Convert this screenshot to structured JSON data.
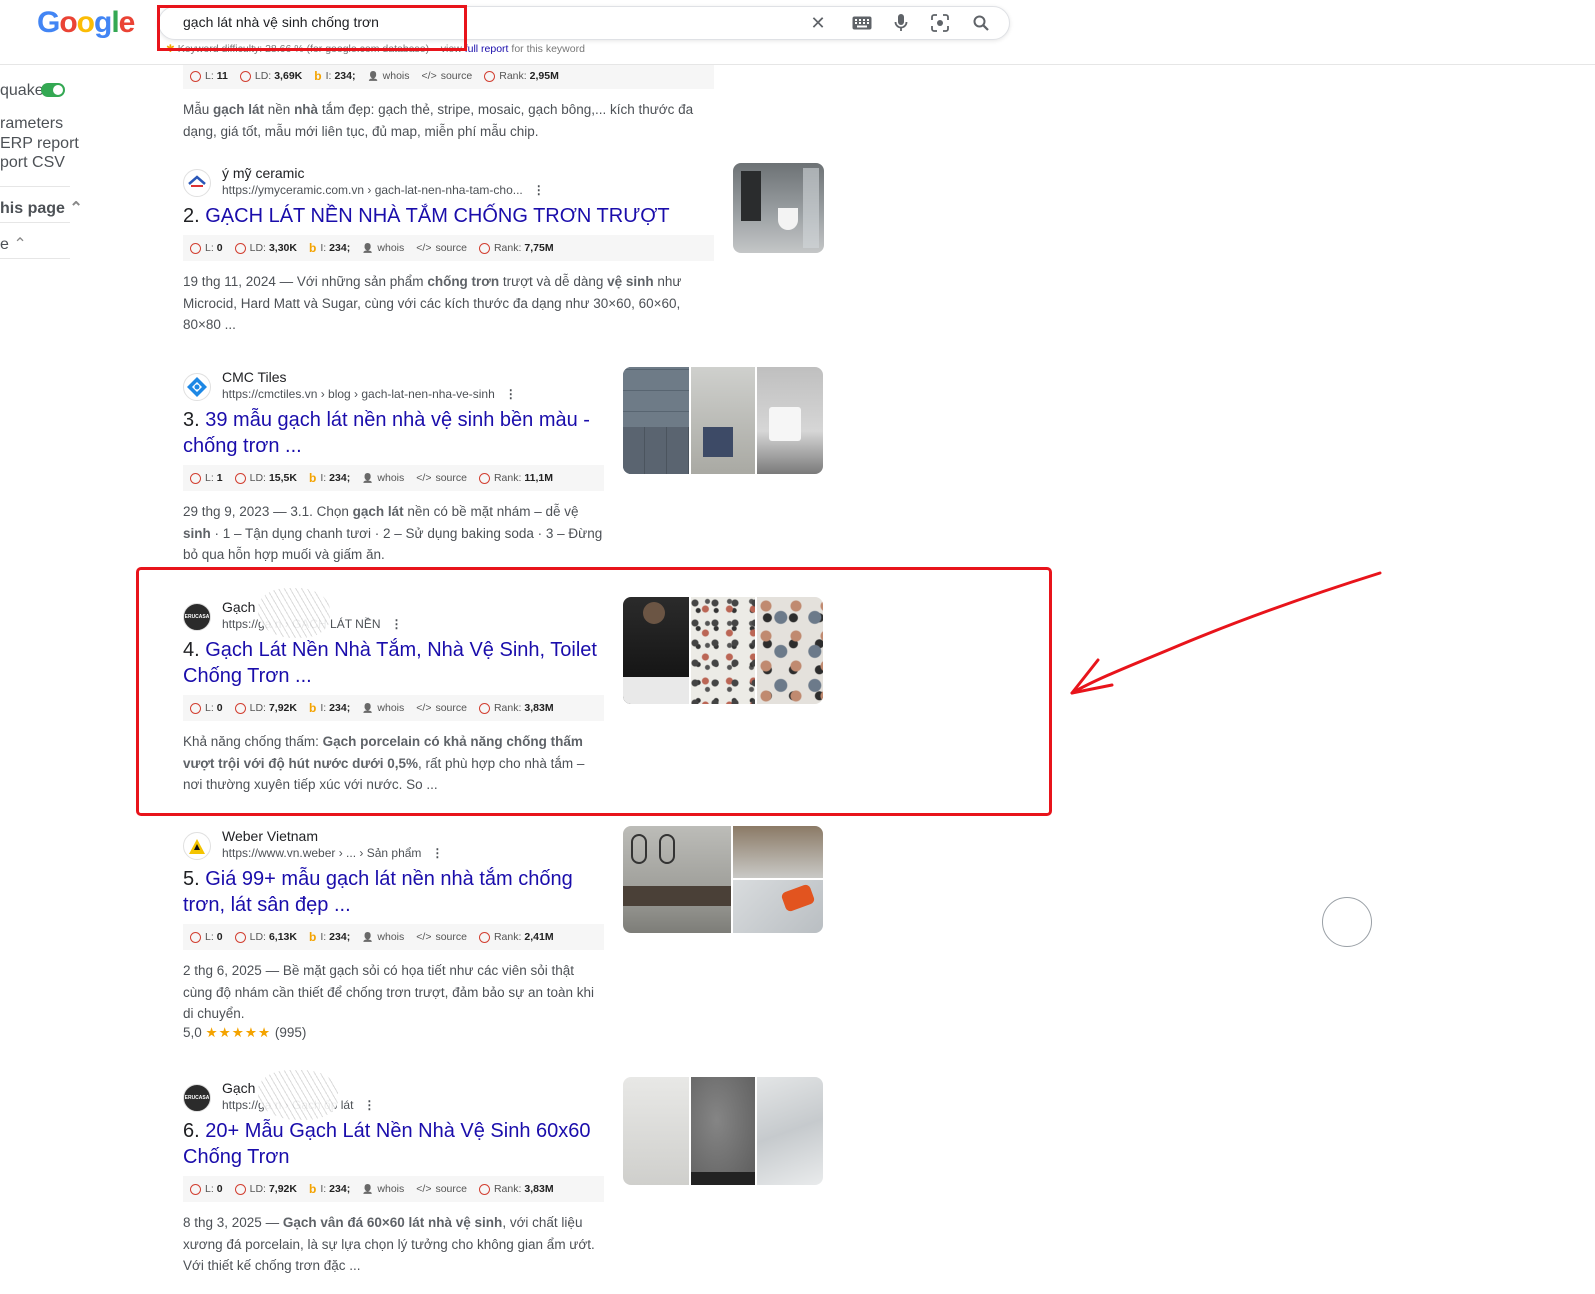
{
  "search": {
    "query": "gạch lát nhà vệ sinh chống trơn",
    "keyword_line_prefix": "Keyword difficulty: 28.66 % (for google.com database) – view",
    "keyword_line_link": "full report",
    "keyword_line_suffix": "for this keyword"
  },
  "logo": [
    "G",
    "o",
    "o",
    "g",
    "l",
    "e"
  ],
  "logo_colors": [
    "#4285f4",
    "#ea4335",
    "#fbbc05",
    "#4285f4",
    "#34a853",
    "#ea4335"
  ],
  "left_panel": {
    "toggle_label": "quake",
    "items": [
      "rameters",
      "ERP report",
      "port CSV"
    ],
    "this_page": "his page",
    "last": "e"
  },
  "metric_labels": {
    "l": "L:",
    "ld": "LD:",
    "i": "I:",
    "whois": "whois",
    "source": "source",
    "rank": "Rank:"
  },
  "result0": {
    "metrics": {
      "l": "11",
      "ld": "3,69K",
      "i": "234;",
      "rank": "2,95M"
    },
    "snippet": "Mẫu <b>gạch lát</b> nền <b>nhà</b> tắm đẹp: gạch thẻ, stripe, mosaic, gạch bông,... kích thước đa dạng, giá tốt, mẫu mới liên tục, đủ map, miễn phí mẫu chip."
  },
  "results": [
    {
      "site": "ý mỹ ceramic",
      "url": "https://ymyceramic.com.vn › gach-lat-nen-nha-tam-cho...",
      "num": "2.",
      "title": "GẠCH LÁT NỀN NHÀ TẮM CHỐNG TRƠN TRƯỢT",
      "metrics": {
        "l": "0",
        "ld": "3,30K",
        "i": "234;",
        "rank": "7,75M"
      },
      "snippet": "19 thg 11, 2024 — Với những sản phẩm <b>chống trơn</b> trượt và dễ dàng <b>vệ sinh</b> như Microcid, Hard Matt và Sugar, cùng với các kích thước đa dạng như 30×60, 60×60, 80×80 ..."
    },
    {
      "site": "CMC Tiles",
      "url": "https://cmctiles.vn › blog › gach-lat-nen-nha-ve-sinh",
      "num": "3.",
      "title": "39 mẫu gạch lát nền nhà vệ sinh bền màu - chống trơn ...",
      "metrics": {
        "l": "1",
        "ld": "15,5K",
        "i": "234;",
        "rank": "11,1M"
      },
      "snippet": "29 thg 9, 2023 — 3.1. Chọn <b>gạch lát</b> nền có bề mặt nhám – dễ vệ <b>sinh</b> · 1 – Tận dụng chanh tươi · 2 – Sử dụng baking soda · 3 – Đừng bỏ qua hỗn hợp muối và giấm ăn."
    },
    {
      "site": "Gạch",
      "url": "https://ga        n › GẠCH LÁT NỀN",
      "num": "4.",
      "title": "Gạch Lát Nền Nhà Tắm, Nhà Vệ Sinh, Toilet Chống Trơn ...",
      "metrics": {
        "l": "0",
        "ld": "7,92K",
        "i": "234;",
        "rank": "3,83M"
      },
      "snippet": "Khả năng chống thấm: <b>Gạch porcelain có khả năng chống thấm vượt trội với độ hút nước dưới 0,5%</b>, rất phù hợp cho nhà tắm – nơi thường xuyên tiếp xúc với nước. So ..."
    },
    {
      "site": "Weber Vietnam",
      "url": "https://www.vn.weber › ... › Sản phẩm",
      "num": "5.",
      "title": "Giá 99+ mẫu gạch lát nền nhà tắm chống trơn, lát sân đẹp ...",
      "metrics": {
        "l": "0",
        "ld": "6,13K",
        "i": "234;",
        "rank": "2,41M"
      },
      "snippet": "2 thg 6, 2025 — Bề mặt gạch sỏi có họa tiết như các viên sỏi thật cùng độ nhám cần thiết để chống trơn trượt, đảm bảo sự an toàn khi di chuyển.",
      "rating_value": "5,0",
      "rating_stars": "★★★★★",
      "rating_count": "(995)"
    },
    {
      "site": "Gạch",
      "url": "https://ga         n › Gạch ốp lát",
      "num": "6.",
      "title": "20+ Mẫu Gạch Lát Nền Nhà Vệ Sinh 60x60 Chống Trơn",
      "metrics": {
        "l": "0",
        "ld": "7,92K",
        "i": "234;",
        "rank": "3,83M"
      },
      "snippet": "8 thg 3, 2025 — <b>Gạch vân đá 60×60 lát nhà vệ sinh</b>, với chất liệu xương đá porcelain, là sự lựa chọn lý tưởng cho không gian ẩm ướt. Với thiết kế chống trơn đặc ..."
    }
  ],
  "favicon_text": {
    "erucasa": "ERUCASA"
  },
  "colors": {
    "link": "#1a0dab",
    "annotation": "#e8141b",
    "metric_circle": "#d23f31",
    "bing": "#f4a300",
    "toggle": "#34a853"
  }
}
